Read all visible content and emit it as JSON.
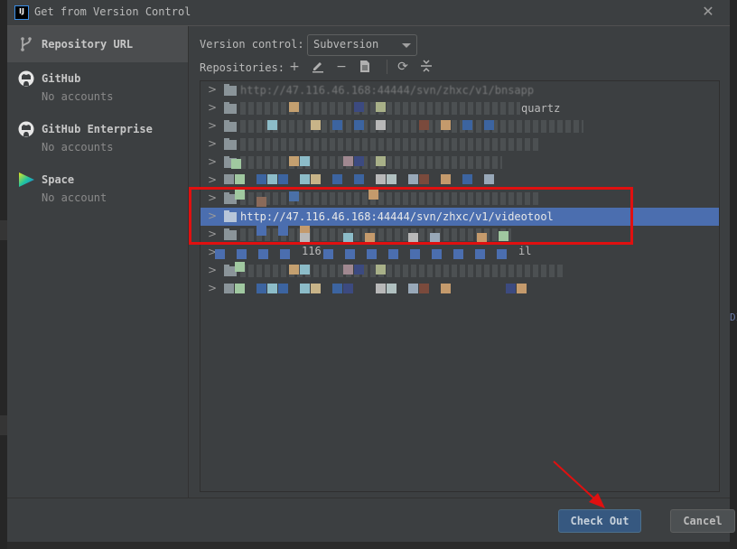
{
  "dialog": {
    "title": "Get from Version Control",
    "app_icon_text": "IJ"
  },
  "sidebar": {
    "items": [
      {
        "label": "Repository URL",
        "sub": "",
        "icon": "branch-icon",
        "selected": true
      },
      {
        "label": "GitHub",
        "sub": "No accounts",
        "icon": "github-icon"
      },
      {
        "label": "GitHub Enterprise",
        "sub": "No accounts",
        "icon": "github-icon"
      },
      {
        "label": "Space",
        "sub": "No account",
        "icon": "space-icon"
      }
    ]
  },
  "main": {
    "version_control_label": "Version control:",
    "version_control_value": "Subversion",
    "repositories_label": "Repositories:",
    "toolbar": [
      "add-icon",
      "edit-icon",
      "remove-icon",
      "browse-icon",
      "refresh-icon",
      "collapse-all-icon"
    ],
    "tree": {
      "rows": [
        {
          "text": "http://47.116.46.168:44444/svn/zhxc/v1/bnsapp",
          "obscured": true
        },
        {
          "text": "quartz",
          "obscured": true
        },
        {
          "text": "",
          "obscured": true
        },
        {
          "text": "",
          "obscured": true
        },
        {
          "text": "",
          "obscured": true
        },
        {
          "text": "",
          "obscured": true
        },
        {
          "text": "",
          "obscured": true
        },
        {
          "text": "http://47.116.46.168:44444/svn/zhxc/v1/videotool",
          "obscured": false,
          "selected": true
        },
        {
          "text": "",
          "obscured": true
        },
        {
          "text": "116",
          "tail": "il",
          "obscured": true
        },
        {
          "text": "",
          "obscured": true
        },
        {
          "text": "",
          "obscured": true
        }
      ]
    }
  },
  "footer": {
    "checkout_label": "Check Out",
    "cancel_label": "Cancel"
  },
  "annotations": {
    "highlight_color": "#e01010",
    "arrow_color": "#e01010"
  },
  "background_peek_text": "DI"
}
